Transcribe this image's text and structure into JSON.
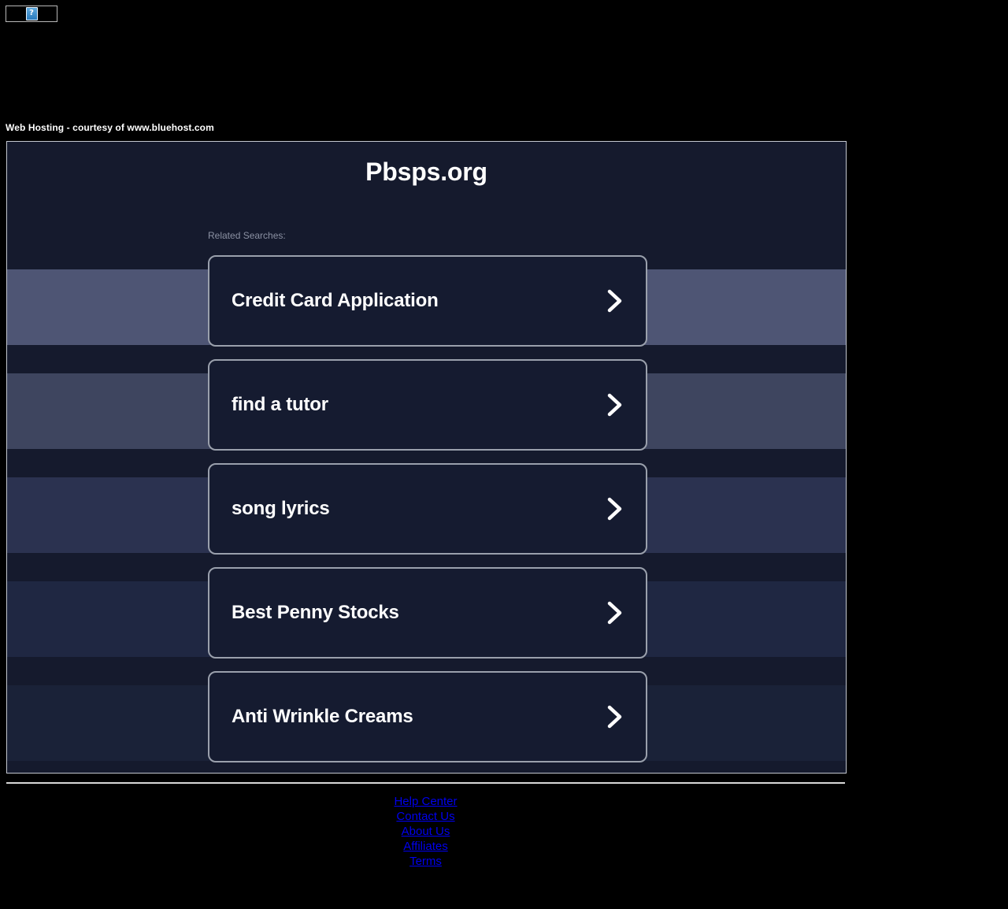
{
  "browser": {
    "broken_image_icon": "broken-image-placeholder",
    "broken_image_glyph": "?"
  },
  "host_notice": {
    "text": "Web Hosting - courtesy of www.bluehost.com"
  },
  "page": {
    "title": "Pbsps.org",
    "related_label": "Related Searches:",
    "chevron_icon": "chevron-right-icon",
    "cards": [
      {
        "label": "Credit Card Application"
      },
      {
        "label": "find a tutor"
      },
      {
        "label": "song lyrics"
      },
      {
        "label": "Best Penny Stocks"
      },
      {
        "label": "Anti Wrinkle Creams"
      }
    ]
  },
  "footer": {
    "links": [
      {
        "label": "Help Center"
      },
      {
        "label": "Contact Us"
      },
      {
        "label": "About Us"
      },
      {
        "label": "Affiliates"
      },
      {
        "label": "Terms"
      }
    ]
  },
  "colors": {
    "page_background": "#000000",
    "frame_background": "#151a2d",
    "frame_border": "#c3c7cf",
    "card_background": "#151b30",
    "card_border": "#9aa0ac",
    "card_text": "#ffffff",
    "related_label": "#8b91a3",
    "link_blue": "#0000ee",
    "band_1": "#4e5574",
    "band_2": "#3e455f",
    "band_3": "#2b3250",
    "band_4": "#1f2742",
    "band_5": "#1a2238"
  }
}
